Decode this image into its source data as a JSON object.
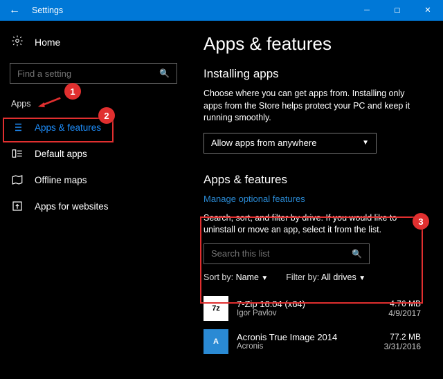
{
  "window": {
    "title": "Settings"
  },
  "sidebar": {
    "home": "Home",
    "search_placeholder": "Find a setting",
    "category": "Apps",
    "items": [
      {
        "label": "Apps & features"
      },
      {
        "label": "Default apps"
      },
      {
        "label": "Offline maps"
      },
      {
        "label": "Apps for websites"
      }
    ]
  },
  "main": {
    "heading": "Apps & features",
    "install_title": "Installing apps",
    "install_desc": "Choose where you can get apps from. Installing only apps from the Store helps protect your PC and keep it running smoothly.",
    "combo_value": "Allow apps from anywhere",
    "section2_title": "Apps & features",
    "manage_link": "Manage optional features",
    "filter_desc": "Search, sort, and filter by drive. If you would like to uninstall or move an app, select it from the list.",
    "list_search_placeholder": "Search this list",
    "sort_label": "Sort by:",
    "sort_value": "Name",
    "filter_label": "Filter by:",
    "filter_value": "All drives",
    "apps": [
      {
        "icon": "7z",
        "name": "7-Zip 16.04 (x64)",
        "publisher": "Igor Pavlov",
        "size": "4.76 MB",
        "date": "4/9/2017"
      },
      {
        "icon": "A",
        "name": "Acronis True Image 2014",
        "publisher": "Acronis",
        "size": "77.2 MB",
        "date": "3/31/2016"
      }
    ]
  },
  "annotations": {
    "c1": "1",
    "c2": "2",
    "c3": "3"
  }
}
